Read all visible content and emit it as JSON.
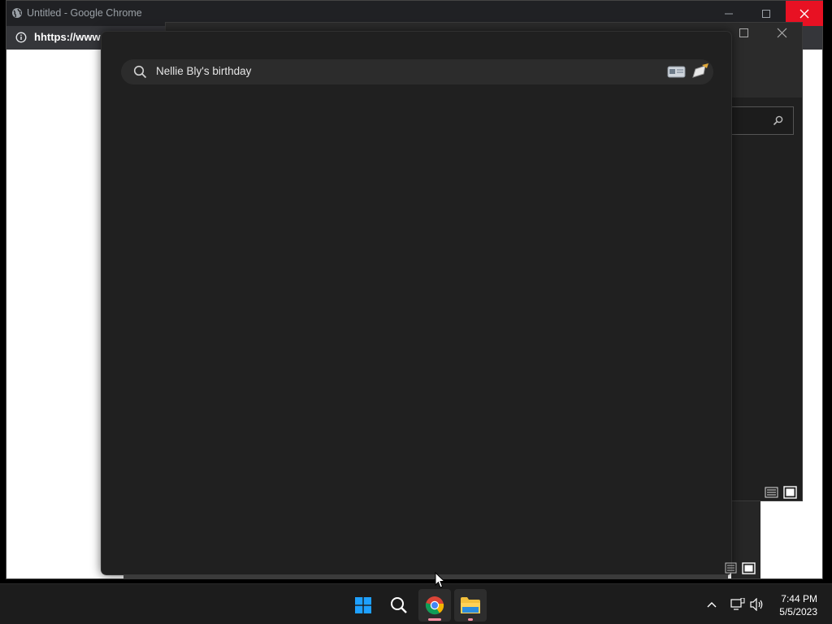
{
  "chrome": {
    "window_title": "Untitled - Google Chrome",
    "address_text": "hhttps://www"
  },
  "search": {
    "query": "Nellie Bly's birthday"
  },
  "taskbar": {
    "apps": [
      {
        "name": "Start",
        "icon": "windows-logo-icon"
      },
      {
        "name": "Search",
        "icon": "search-icon"
      },
      {
        "name": "Google Chrome",
        "icon": "chrome-icon",
        "active": true
      },
      {
        "name": "File Explorer",
        "icon": "folder-icon",
        "active": true
      }
    ],
    "time": "7:44 PM",
    "date": "5/5/2023"
  },
  "colors": {
    "close_red": "#e81123",
    "panel_dark": "#202020",
    "windows_blue": "#1ea0ff",
    "active_indicator": "#ff8fa3"
  }
}
